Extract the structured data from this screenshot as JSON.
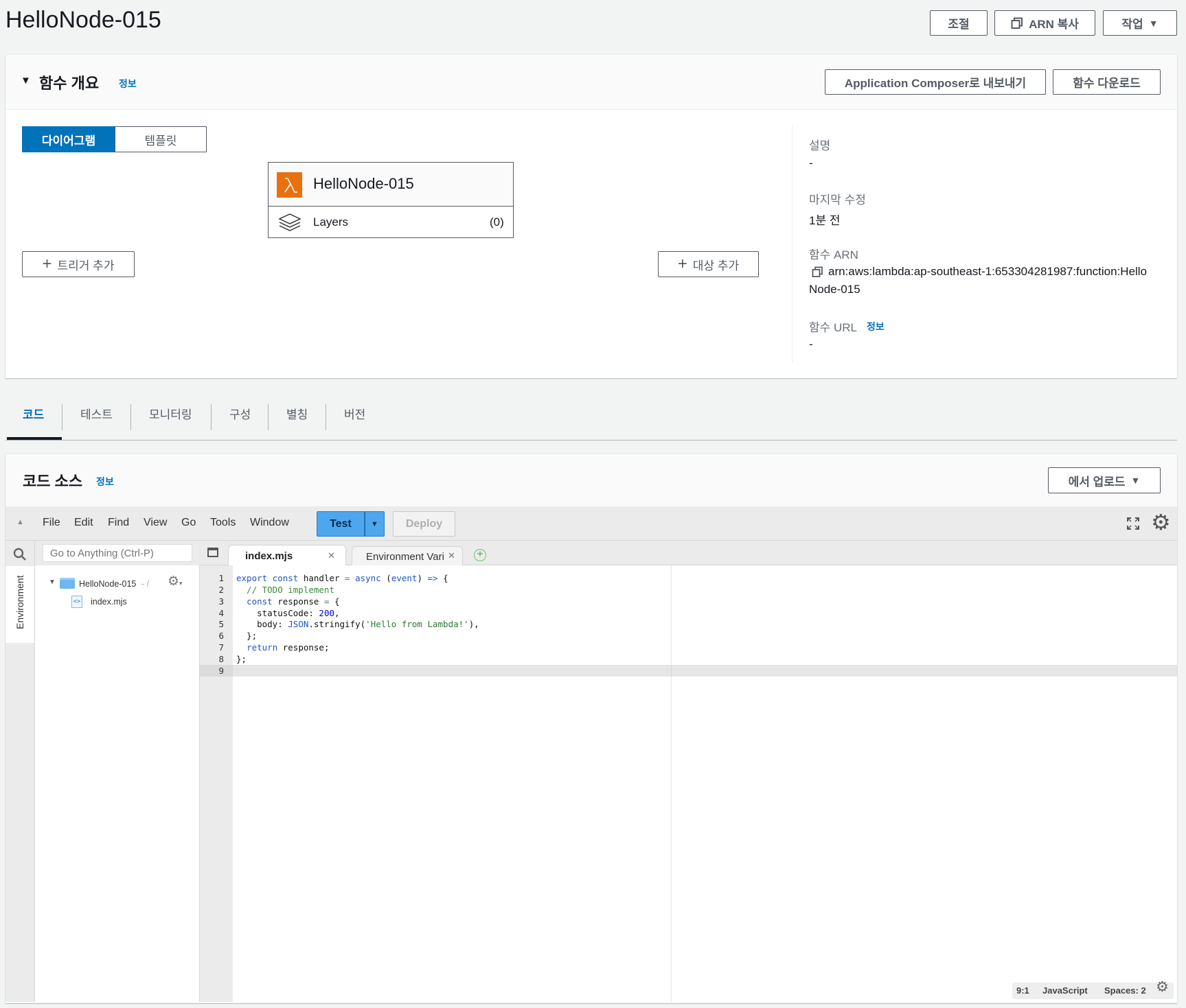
{
  "page": {
    "title": "HelloNode-015",
    "actions": {
      "throttle": "조절",
      "copy_arn": "ARN 복사",
      "actions": "작업"
    }
  },
  "overview": {
    "heading": "함수 개요",
    "info": "정보",
    "export_composer": "Application Composer로 내보내기",
    "download": "함수 다운로드",
    "toggle": {
      "diagram": "다이어그램",
      "template": "템플릿"
    },
    "function_card": {
      "name": "HelloNode-015",
      "layers_label": "Layers",
      "layers_count": "(0)"
    },
    "add_trigger": "트리거 추가",
    "add_destination": "대상 추가",
    "details": {
      "description_label": "설명",
      "description_value": "-",
      "last_modified_label": "마지막 수정",
      "last_modified_value": "1분 전",
      "arn_label": "함수 ARN",
      "arn_value_line1": "arn:aws:lambda:ap-southeast-1:653304281987:function:Hello",
      "arn_value_line2": "Node-015",
      "url_label": "함수 URL",
      "url_info": "정보",
      "url_value": "-"
    }
  },
  "tabs": [
    "코드",
    "테스트",
    "모니터링",
    "구성",
    "별칭",
    "버전"
  ],
  "active_tab": "코드",
  "code_source": {
    "heading": "코드 소스",
    "info": "정보",
    "upload": "에서 업로드"
  },
  "ide": {
    "menu": [
      "File",
      "Edit",
      "Find",
      "View",
      "Go",
      "Tools",
      "Window"
    ],
    "test_label": "Test",
    "deploy_label": "Deploy",
    "search_placeholder": "Go to Anything (Ctrl-P)",
    "environment_label": "Environment",
    "tree": {
      "root": "HelloNode-015",
      "root_suffix": "- /",
      "file": "index.mjs"
    },
    "editor_tabs": [
      {
        "label": "index.mjs",
        "active": true
      },
      {
        "label": "Environment Vari",
        "active": false
      }
    ],
    "line_numbers": [
      "1",
      "2",
      "3",
      "4",
      "5",
      "6",
      "7",
      "8",
      "9"
    ],
    "status": {
      "position": "9:1",
      "language": "JavaScript",
      "spaces": "Spaces: 2"
    }
  },
  "colors": {
    "primary_blue": "#0073bb",
    "test_button": "#4ea6ef",
    "lambda_orange": "#e8700f",
    "page_bg": "#f2f3f3"
  }
}
